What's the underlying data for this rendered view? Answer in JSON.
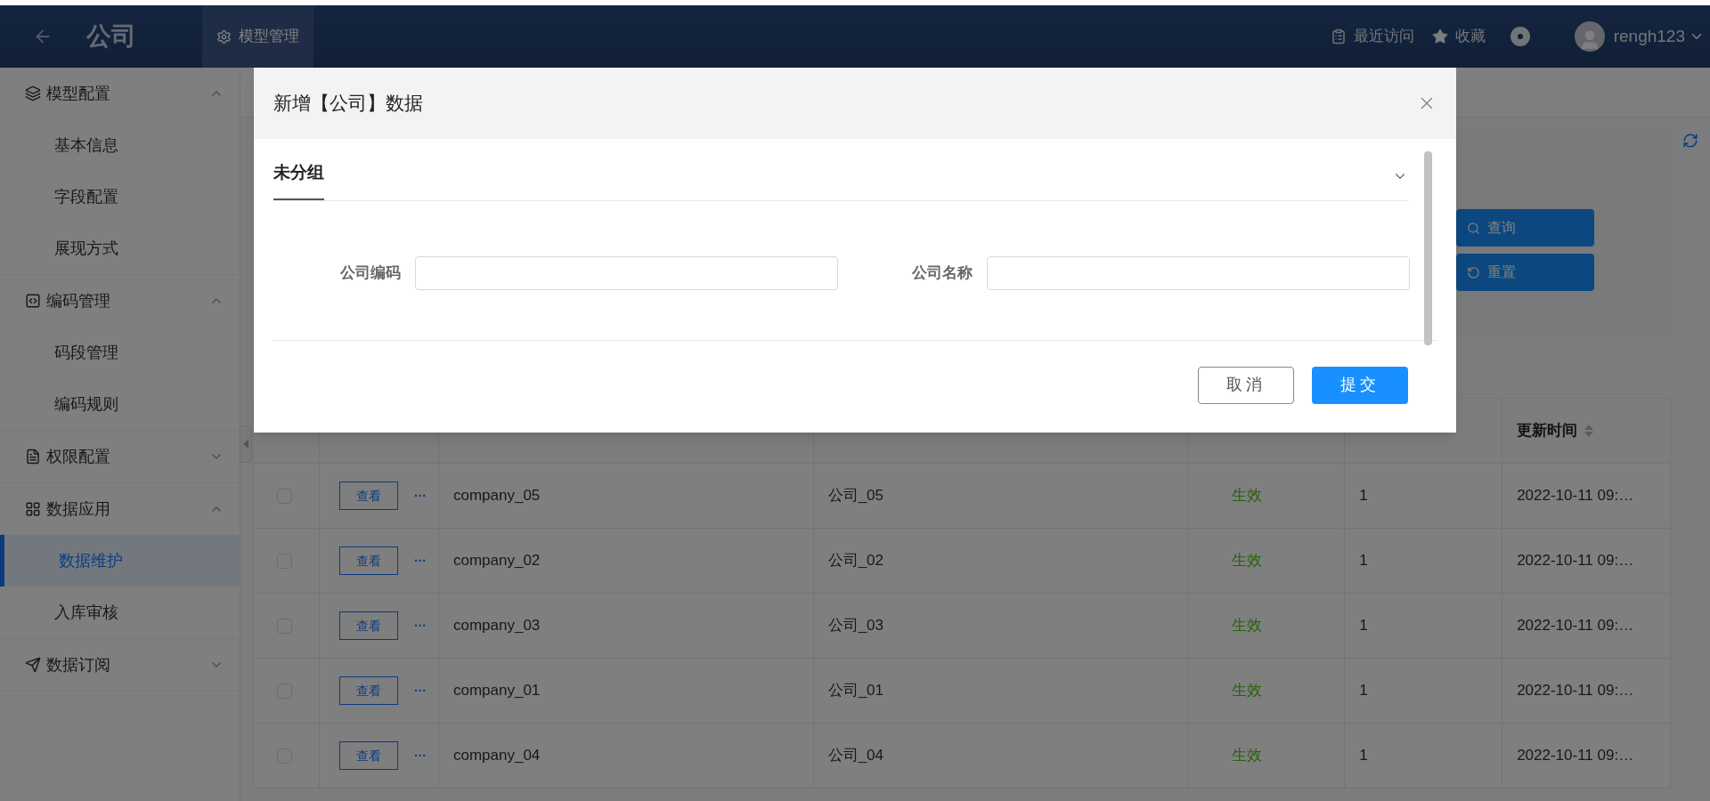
{
  "topbar": {
    "title": "公司",
    "tabs": [
      {
        "label": "模型管理",
        "selected": true
      }
    ],
    "links": [
      {
        "label": "最近访问",
        "kind": "history"
      },
      {
        "label": "收藏",
        "kind": "star"
      }
    ],
    "user": "rengh123"
  },
  "sidebar": {
    "groups": [
      {
        "label": "模型配置",
        "kind": "model",
        "expanded": true,
        "children": [
          {
            "label": "基本信息",
            "selected": false
          },
          {
            "label": "字段配置",
            "selected": false
          },
          {
            "label": "展现方式",
            "selected": false
          }
        ]
      },
      {
        "label": "编码管理",
        "kind": "code",
        "expanded": true,
        "children": [
          {
            "label": "码段管理",
            "selected": false
          },
          {
            "label": "编码规则",
            "selected": false
          }
        ]
      },
      {
        "label": "权限配置",
        "kind": "permission",
        "expanded": false
      },
      {
        "label": "数据应用",
        "kind": "apps",
        "expanded": true,
        "children": [
          {
            "label": "数据维护",
            "selected": true
          },
          {
            "label": "入库审核",
            "selected": false
          }
        ]
      },
      {
        "label": "数据订阅",
        "kind": "subscribe",
        "expanded": false
      }
    ]
  },
  "search_panel": {
    "buttons": [
      {
        "label": "查询",
        "kind": "search"
      },
      {
        "label": "重置",
        "kind": "reset"
      }
    ]
  },
  "table": {
    "columns": [
      {},
      {},
      {},
      {},
      {},
      {},
      {
        "label": "更新时间",
        "sortable": true
      }
    ],
    "rows": [
      {
        "checked": false,
        "action": "查看",
        "more": "···",
        "code": "company_05",
        "name": "公司_05",
        "status": "生效",
        "count": "1",
        "updated": "2022-10-11 09:…"
      },
      {
        "checked": false,
        "action": "查看",
        "more": "···",
        "code": "company_02",
        "name": "公司_02",
        "status": "生效",
        "count": "1",
        "updated": "2022-10-11 09:…"
      },
      {
        "checked": false,
        "action": "查看",
        "more": "···",
        "code": "company_03",
        "name": "公司_03",
        "status": "生效",
        "count": "1",
        "updated": "2022-10-11 09:…"
      },
      {
        "checked": false,
        "action": "查看",
        "more": "···",
        "code": "company_01",
        "name": "公司_01",
        "status": "生效",
        "count": "1",
        "updated": "2022-10-11 09:…"
      },
      {
        "checked": false,
        "action": "查看",
        "more": "···",
        "code": "company_04",
        "name": "公司_04",
        "status": "生效",
        "count": "1",
        "updated": "2022-10-11 09:…"
      }
    ]
  },
  "dialog": {
    "title": "新增【公司】数据",
    "section": {
      "title": "未分组",
      "expanded": true
    },
    "fields": [
      {
        "label": "公司编码"
      },
      {
        "label": "公司名称"
      }
    ],
    "buttons": [
      {
        "label": "取消",
        "kind": "default"
      },
      {
        "label": "提交",
        "kind": "primary"
      }
    ]
  }
}
